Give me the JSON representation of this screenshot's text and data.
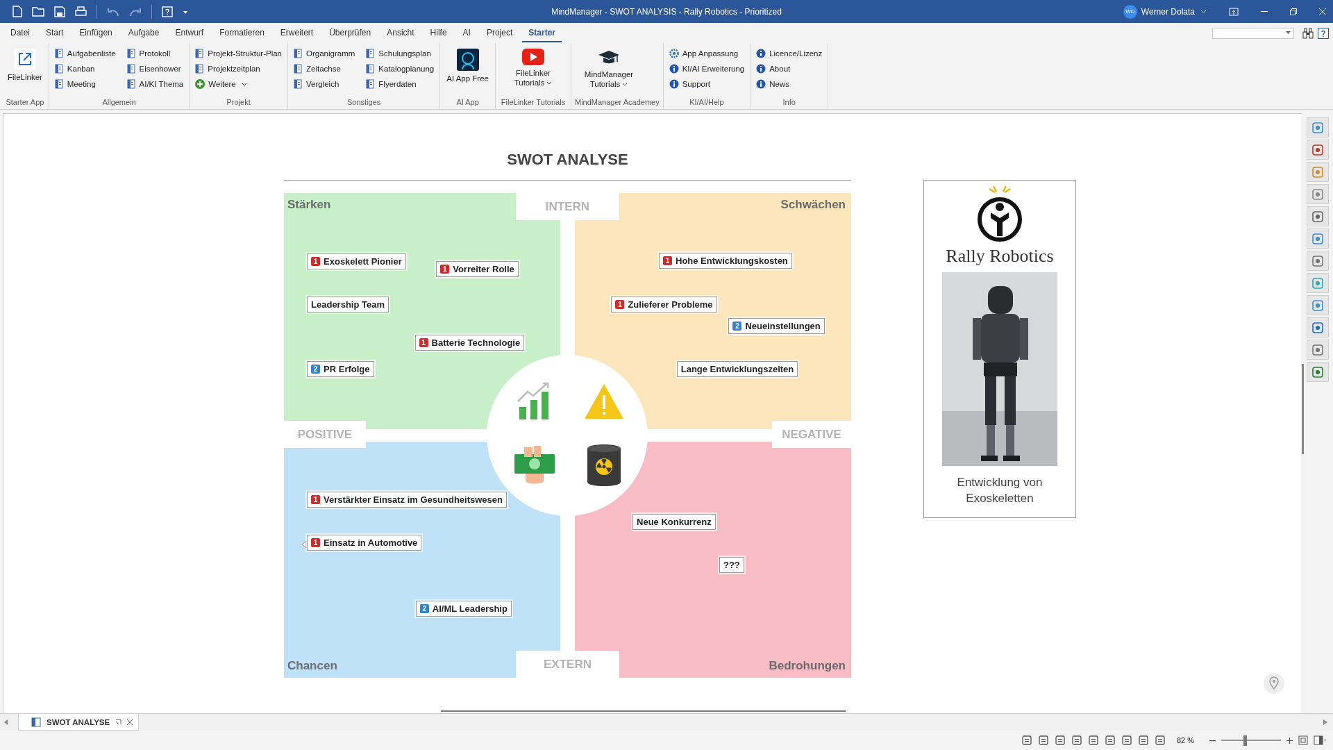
{
  "window": {
    "title": "MindManager - SWOT ANALYSIS - Rally Robotics - Prioritized",
    "user_initials": "WD",
    "user_name": "Werner Dolata"
  },
  "menu_tabs": [
    {
      "label": "Datei",
      "selected": false
    },
    {
      "label": "Start",
      "selected": false
    },
    {
      "label": "Einfügen",
      "selected": false
    },
    {
      "label": "Aufgabe",
      "selected": false
    },
    {
      "label": "Entwurf",
      "selected": false
    },
    {
      "label": "Formatieren",
      "selected": false
    },
    {
      "label": "Erweitert",
      "selected": false
    },
    {
      "label": "Überprüfen",
      "selected": false
    },
    {
      "label": "Ansicht",
      "selected": false
    },
    {
      "label": "Hilfe",
      "selected": false
    },
    {
      "label": "AI",
      "selected": false
    },
    {
      "label": "Project",
      "selected": false
    },
    {
      "label": "Starter",
      "selected": true
    }
  ],
  "ribbon_groups": [
    {
      "label": "Starter App",
      "items": [
        {
          "label": "FileLinker",
          "kind": "link"
        }
      ]
    },
    {
      "label": "Allgemein",
      "items": [
        {
          "label": "Aufgabenliste",
          "kind": "doc"
        },
        {
          "label": "Kanban",
          "kind": "doc"
        },
        {
          "label": "Meeting",
          "kind": "doc"
        },
        {
          "label": "Protokoll",
          "kind": "doc"
        },
        {
          "label": "Eisenhower",
          "kind": "doc"
        },
        {
          "label": "AI/KI Thema",
          "kind": "doc"
        }
      ]
    },
    {
      "label": "Projekt",
      "items": [
        {
          "label": "Projekt-Struktur-Plan",
          "kind": "doc"
        },
        {
          "label": "Projektzeitplan",
          "kind": "doc"
        },
        {
          "label": "Weitere",
          "kind": "plus"
        }
      ]
    },
    {
      "label": "Sonstiges",
      "items": [
        {
          "label": "Organigramm",
          "kind": "doc"
        },
        {
          "label": "Zeitachse",
          "kind": "doc"
        },
        {
          "label": "Vergleich",
          "kind": "doc"
        },
        {
          "label": "Schulungsplan",
          "kind": "doc"
        },
        {
          "label": "Katalogplanung",
          "kind": "doc"
        },
        {
          "label": "Flyerdaten",
          "kind": "doc"
        }
      ]
    },
    {
      "label": "AI App",
      "items": [
        {
          "label": "AI App Free",
          "kind": "ai"
        }
      ]
    },
    {
      "label": "FileLinker Tutorials",
      "items": [
        {
          "label": "FileLinker Tutorials",
          "kind": "video"
        }
      ]
    },
    {
      "label": "MindManager Academey",
      "items": [
        {
          "label": "MindManager Tutorials",
          "kind": "cap"
        }
      ]
    },
    {
      "label": "KI/AI/Help",
      "items": [
        {
          "label": "App Anpassung",
          "kind": "gear"
        },
        {
          "label": "KI/AI Erweiterung",
          "kind": "info"
        },
        {
          "label": "Support",
          "kind": "info"
        }
      ]
    },
    {
      "label": "Info",
      "items": [
        {
          "label": "Licence/Lizenz",
          "kind": "info"
        },
        {
          "label": "About",
          "kind": "info"
        },
        {
          "label": "News",
          "kind": "info"
        }
      ]
    }
  ],
  "document": {
    "title": "SWOT ANALYSE",
    "axes": {
      "top": "INTERN",
      "bottom": "EXTERN",
      "left": "POSITIVE",
      "right": "NEGATIVE"
    },
    "quadrants": [
      {
        "label": "Stärken",
        "color": "#c8f0c8",
        "topics": [
          {
            "text": "Exoskelett Pionier",
            "priority": "1",
            "color": "#d42a2a",
            "handle": false
          },
          {
            "text": "Vorreiter Rolle",
            "priority": "1",
            "color": "#d42a2a",
            "handle": false
          },
          {
            "text": "Leadership Team",
            "handle": false
          },
          {
            "text": "Batterie Technologie",
            "priority": "1",
            "color": "#d42a2a",
            "handle": false
          },
          {
            "text": "PR Erfolge",
            "priority": "2",
            "color": "#2d86d4",
            "handle": false
          }
        ]
      },
      {
        "label": "Schwächen",
        "color": "#fbe6bb",
        "topics": [
          {
            "text": "Hohe Entwicklungskosten",
            "priority": "1",
            "color": "#d42a2a",
            "handle": false
          },
          {
            "text": "Zulieferer Probleme",
            "priority": "1",
            "color": "#d42a2a",
            "handle": false
          },
          {
            "text": "Neueinstellungen",
            "priority": "2",
            "color": "#2d86d4",
            "handle": false
          },
          {
            "text": "Lange Entwicklungszeiten",
            "handle": false
          }
        ]
      },
      {
        "label": "Chancen",
        "color": "#bfe2f8",
        "topics": [
          {
            "text": "Verstärkter Einsatz im Gesundheitswesen",
            "priority": "1",
            "color": "#d42a2a",
            "handle": false
          },
          {
            "text": "Einsatz in Automotive",
            "priority": "1",
            "color": "#d42a2a",
            "handle": true
          },
          {
            "text": "AI/ML Leadership",
            "priority": "2",
            "color": "#2d86d4",
            "handle": false
          }
        ]
      },
      {
        "label": "Bedrohungen",
        "color": "#f8bcc5",
        "topics": [
          {
            "text": "Neue Konkurrenz",
            "handle": false
          },
          {
            "text": "???",
            "handle": false
          }
        ]
      }
    ]
  },
  "side_card": {
    "brand": "Rally Robotics",
    "caption": "Entwicklung von Exoskeletten"
  },
  "document_tabs": [
    {
      "label": "SWOT ANALYSE",
      "selected": true
    }
  ],
  "status_bar": {
    "zoom": "82 %",
    "zoom_slider": {
      "level": 0.41
    }
  }
}
